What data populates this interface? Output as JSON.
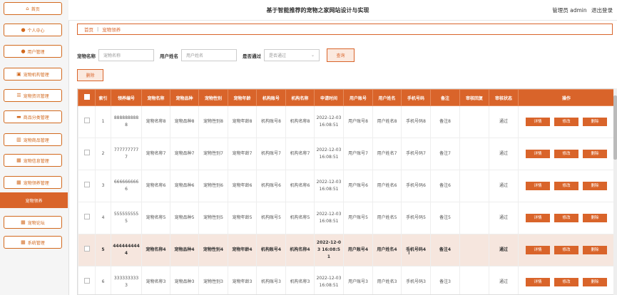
{
  "header": {
    "title": "基于智能推荐的宠物之家网站设计与实现",
    "user_label": "管理员 admin",
    "logout_label": "退出登录"
  },
  "sidebar": {
    "items": [
      {
        "label": "首页",
        "icon": "home-icon",
        "glyph": "⌂"
      },
      {
        "label": "个人中心",
        "icon": "person-icon",
        "glyph": "●"
      },
      {
        "label": "用户管理",
        "icon": "person-icon",
        "glyph": "●"
      },
      {
        "label": "宠物机构管理",
        "icon": "building-icon",
        "glyph": "▣"
      },
      {
        "label": "宠物资讯管理",
        "icon": "sliders-icon",
        "glyph": "☰"
      },
      {
        "label": "商品分类管理",
        "icon": "monitor-icon",
        "glyph": "▬"
      },
      {
        "label": "宠物商品管理",
        "icon": "chart-icon",
        "glyph": "▥"
      },
      {
        "label": "宠物信息管理",
        "icon": "grid-icon",
        "glyph": "▦"
      },
      {
        "label": "宠物领养管理",
        "icon": "grid-icon",
        "glyph": "▦"
      },
      {
        "label": "宠物领养",
        "icon": "",
        "glyph": ""
      },
      {
        "label": "宠物论坛",
        "icon": "grid-icon",
        "glyph": "▦"
      },
      {
        "label": "系统管理",
        "icon": "grid-icon",
        "glyph": "▦"
      }
    ]
  },
  "breadcrumb": {
    "home": "首页",
    "separator": "|",
    "current": "宠物领养"
  },
  "search": {
    "pet_name_label": "宠物名称",
    "pet_name_placeholder": "宠物名称",
    "user_name_label": "用户姓名",
    "user_name_placeholder": "用户姓名",
    "approved_label": "是否通过",
    "approved_placeholder": "是否通过",
    "search_button": "查询"
  },
  "delete_button": "删除",
  "table": {
    "headers": [
      "",
      "索引",
      "领养编号",
      "宠物名称",
      "宠物品种",
      "宠物性别",
      "宠物年龄",
      "机构账号",
      "机构名称",
      "申请时间",
      "用户账号",
      "用户姓名",
      "手机号码",
      "备注",
      "审核回复",
      "审核状态",
      "操作"
    ],
    "actions": {
      "detail": "详情",
      "edit": "修改",
      "delete": "删除"
    },
    "rows": [
      {
        "index": "1",
        "id": "8888888888",
        "name": "宠物名称8",
        "breed": "宠物品种8",
        "gender": "宠物性别8",
        "age": "宠物年龄8",
        "org_account": "机构账号8",
        "org_name": "机构名称8",
        "time": "2022-12-03 16:08:51",
        "user_account": "用户账号8",
        "user_name": "用户姓名8",
        "phone": "手机号码8",
        "note": "备注8",
        "reply": "",
        "status": "通过"
      },
      {
        "index": "2",
        "id": "7777777777",
        "name": "宠物名称7",
        "breed": "宠物品种7",
        "gender": "宠物性别7",
        "age": "宠物年龄7",
        "org_account": "机构账号7",
        "org_name": "机构名称7",
        "time": "2022-12-03 16:08:51",
        "user_account": "用户账号7",
        "user_name": "用户姓名7",
        "phone": "手机号码7",
        "note": "备注7",
        "reply": "",
        "status": "通过"
      },
      {
        "index": "3",
        "id": "6666666666",
        "name": "宠物名称6",
        "breed": "宠物品种6",
        "gender": "宠物性别6",
        "age": "宠物年龄6",
        "org_account": "机构账号6",
        "org_name": "机构名称6",
        "time": "2022-12-03 16:08:51",
        "user_account": "用户账号6",
        "user_name": "用户姓名6",
        "phone": "手机号码6",
        "note": "备注6",
        "reply": "",
        "status": "通过"
      },
      {
        "index": "4",
        "id": "5555555555",
        "name": "宠物名称5",
        "breed": "宠物品种5",
        "gender": "宠物性别5",
        "age": "宠物年龄5",
        "org_account": "机构账号5",
        "org_name": "机构名称5",
        "time": "2022-12-03 16:08:51",
        "user_account": "用户账号5",
        "user_name": "用户姓名5",
        "phone": "手机号码5",
        "note": "备注5",
        "reply": "",
        "status": "通过"
      },
      {
        "index": "5",
        "id": "4444444444",
        "name": "宠物名称4",
        "breed": "宠物品种4",
        "gender": "宠物性别4",
        "age": "宠物年龄4",
        "org_account": "机构账号4",
        "org_name": "机构名称4",
        "time": "2022-12-03 16:08:51",
        "user_account": "用户账号4",
        "user_name": "用户姓名4",
        "phone": "手机号码4",
        "note": "备注4",
        "reply": "",
        "status": "通过",
        "highlighted": true
      },
      {
        "index": "6",
        "id": "3333333333",
        "name": "宠物名称3",
        "breed": "宠物品种3",
        "gender": "宠物性别3",
        "age": "宠物年龄3",
        "org_account": "机构账号3",
        "org_name": "机构名称3",
        "time": "2022-12-03 16:08:51",
        "user_account": "用户账号3",
        "user_name": "用户姓名3",
        "phone": "手机号码3",
        "note": "备注3",
        "reply": "",
        "status": "通过"
      }
    ]
  },
  "colors": {
    "accent": "#d9642a",
    "highlight_row": "#f6e6de"
  }
}
